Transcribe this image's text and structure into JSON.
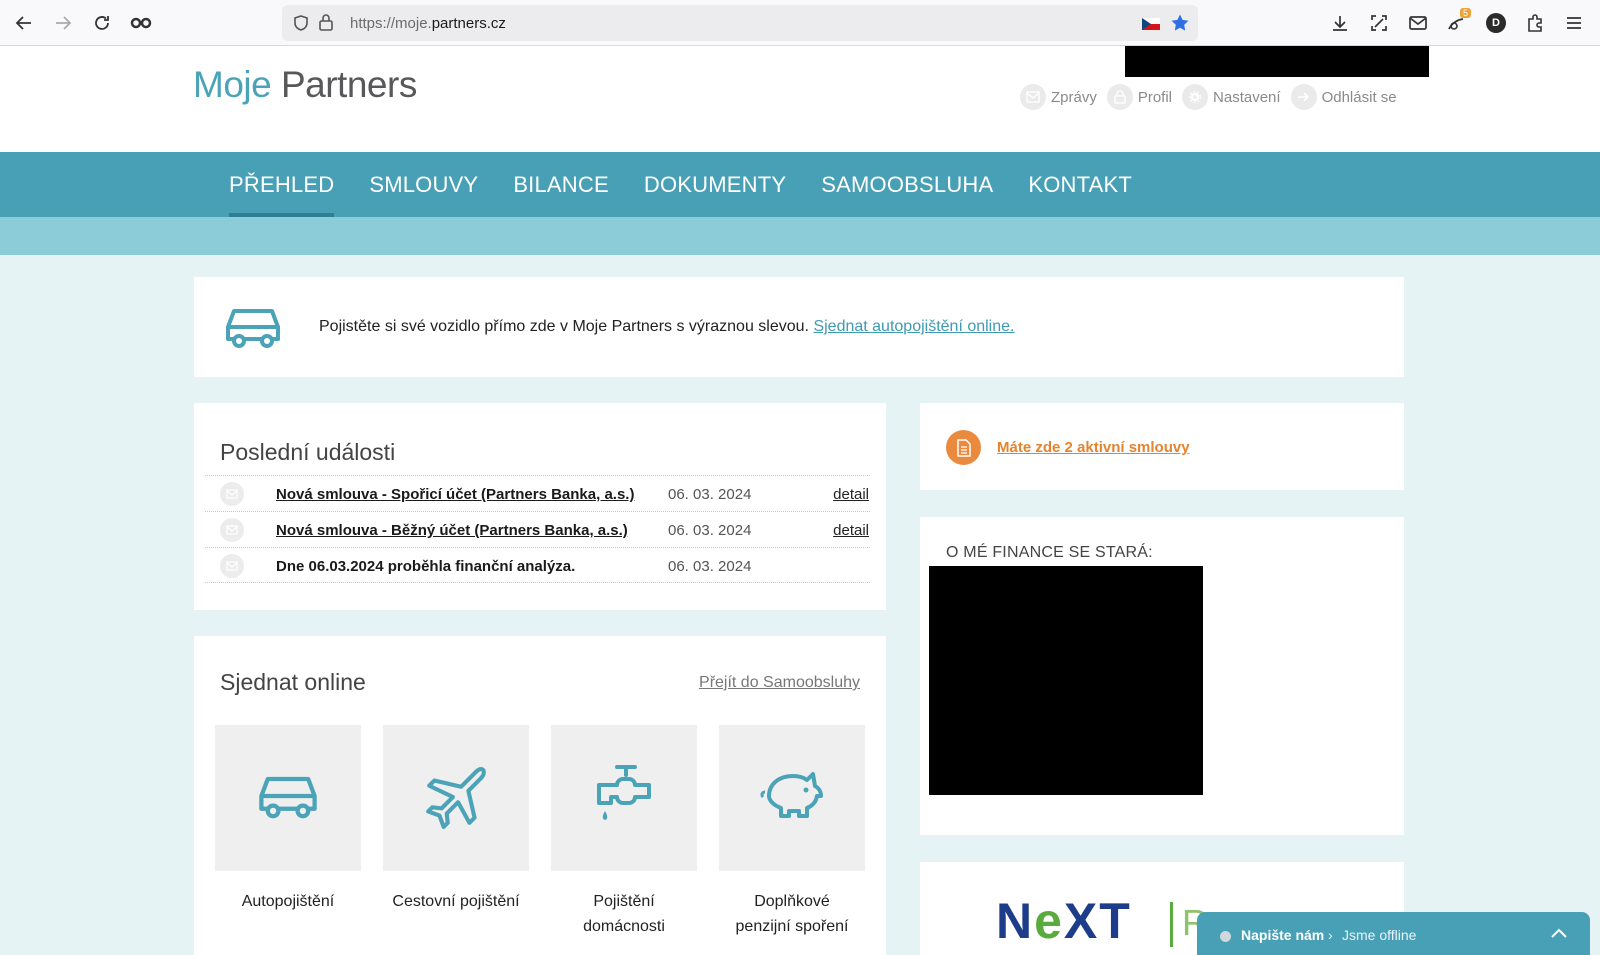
{
  "browser": {
    "url_prefix": "https://moje.",
    "url_domain": "partners.cz",
    "notification_badge": "5",
    "account_initial": "D"
  },
  "header": {
    "logo_part1": "Moje",
    "logo_part2": "Partners",
    "links": {
      "messages": "Zprávy",
      "profile": "Profil",
      "settings": "Nastavení",
      "logout": "Odhlásit se"
    }
  },
  "nav": {
    "overview": "PŘEHLED",
    "contracts": "SMLOUVY",
    "balance": "BILANCE",
    "documents": "DOKUMENTY",
    "selfservice": "SAMOOBSLUHA",
    "contact": "KONTAKT"
  },
  "promo": {
    "text": "Pojistěte si své vozidlo přímo zde v Moje Partners s výraznou slevou.",
    "link": "Sjednat autopojištění online."
  },
  "events": {
    "title": "Poslední události",
    "rows": [
      {
        "title": "Nová smlouva - Spořicí účet (Partners Banka, a.s.)",
        "date": "06. 03. 2024",
        "detail": "detail"
      },
      {
        "title": "Nová smlouva - Běžný účet (Partners Banka, a.s.)",
        "date": "06. 03. 2024",
        "detail": "detail"
      },
      {
        "title": "Dne 06.03.2024 proběhla finanční analýza.",
        "date": "06. 03. 2024"
      }
    ]
  },
  "online": {
    "title": "Sjednat online",
    "goto": "Přejít do Samoobsluhy",
    "tiles": [
      {
        "label": "Autopojištění"
      },
      {
        "label": "Cestovní pojištění"
      },
      {
        "label_line1": "Pojištění",
        "label_line2": "domácnosti"
      },
      {
        "label_line1": "Doplňkové",
        "label_line2": "penzijní spoření"
      }
    ]
  },
  "contracts_panel": {
    "text": "Máte zde 2 aktivní smlouvy"
  },
  "advisor": {
    "label": "O MÉ FINANCE SE STARÁ:"
  },
  "next_logo": {
    "n": "N",
    "e": "e",
    "xt": "XT",
    "r": "R"
  },
  "chat": {
    "title": "Napište nám",
    "status": "Jsme offline"
  },
  "colors": {
    "teal": "#48a0b6",
    "light_teal": "#8ccbd8",
    "orange": "#ea8a3f",
    "bg": "#e6f3f5"
  }
}
